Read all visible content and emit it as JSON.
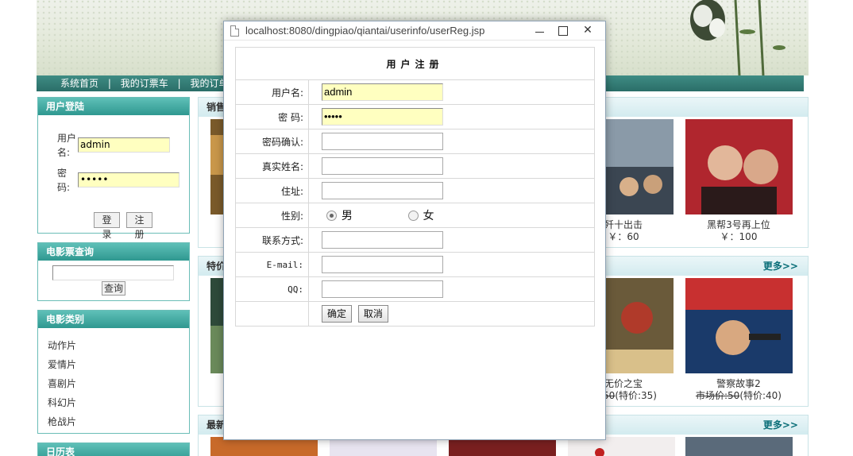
{
  "nav": {
    "items": [
      "系统首页",
      "我的订票车",
      "我的订单"
    ],
    "separator": "|"
  },
  "login_panel": {
    "title": "用户登陆",
    "username_label": "用户名:",
    "username_value": "admin",
    "password_label": "密码:",
    "password_value": "•••••",
    "login_button": "登录",
    "register_button": "注册"
  },
  "search_panel": {
    "title": "电影票查询",
    "input_value": "",
    "search_button": "查询"
  },
  "category_panel": {
    "title": "电影类别",
    "items": [
      "动作片",
      "爱情片",
      "喜剧片",
      "科幻片",
      "枪战片"
    ]
  },
  "calendar_panel": {
    "title": "日历表"
  },
  "sections": {
    "hot": {
      "title": "销售",
      "movies": [
        {
          "name": "歼十出击",
          "price": "￥：60"
        },
        {
          "name": "黑帮3号再上位",
          "price": "￥：100"
        }
      ]
    },
    "special": {
      "title": "特价",
      "more": "更多>>",
      "movies": [
        {
          "name": "无价之宝",
          "market": "价:50",
          "special": "(特价:35)"
        },
        {
          "name": "警察故事2",
          "market": "市场价:50",
          "special": "(特价:40)"
        }
      ]
    },
    "newest": {
      "title": "最新",
      "more": "更多>>"
    }
  },
  "popup": {
    "url": "localhost:8080/dingpiao/qiantai/userinfo/userReg.jsp",
    "form_title": "用户注册",
    "labels": {
      "username": "用户名:",
      "password": "密 码:",
      "confirm": "密码确认:",
      "realname": "真实姓名:",
      "address": "住址:",
      "gender": "性别:",
      "contact": "联系方式:",
      "email": "E-mail:",
      "qq": "QQ:"
    },
    "values": {
      "username": "admin",
      "password": "•••••",
      "confirm": "",
      "realname": "",
      "address": "",
      "contact": "",
      "email": "",
      "qq": ""
    },
    "gender_options": [
      "男",
      "女"
    ],
    "gender_selected": "男",
    "confirm_button": "确定",
    "cancel_button": "取消",
    "window_controls": {
      "close": "✕"
    }
  },
  "colors": {
    "nav_bg": "#2a6e68",
    "panel_head": "#2f9890",
    "field_autofill": "#ffffc0",
    "more_link": "#0a6e78"
  },
  "icons": [
    "document-icon",
    "minimize-icon",
    "maximize-icon",
    "close-icon",
    "flower-icon"
  ]
}
